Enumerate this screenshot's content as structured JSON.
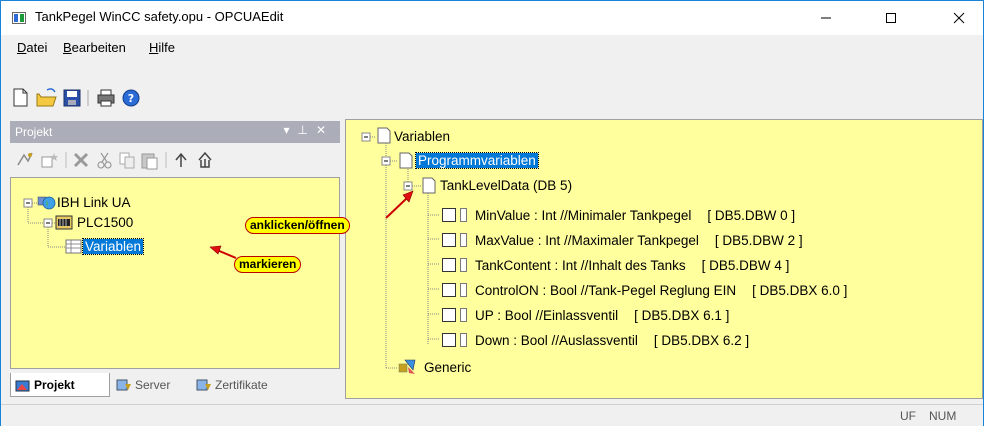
{
  "window": {
    "title": "TankPegel WinCC safety.opu - OPCUAEdit"
  },
  "menu": [
    {
      "label": "Datei",
      "mnemonic": "D",
      "rest": "atei"
    },
    {
      "label": "Bearbeiten",
      "mnemonic": "B",
      "rest": "earbeiten"
    },
    {
      "label": "Hilfe",
      "mnemonic": "H",
      "rest": "ilfe"
    }
  ],
  "toolbar": [
    "new-file-icon",
    "open-folder-icon",
    "save-icon",
    "print-icon",
    "help-icon"
  ],
  "left_panel": {
    "title": "Projekt",
    "tools": [
      "add-connection-icon",
      "add-item-icon",
      "delete-icon",
      "cut-icon",
      "copy-icon",
      "paste-icon",
      "arrow-up-icon",
      "home-up-icon"
    ],
    "tree": {
      "root": "IBH Link UA",
      "plc": "PLC1500",
      "variables": "Variablen"
    },
    "tabs": [
      {
        "label": "Projekt",
        "active": true
      },
      {
        "label": "Server",
        "active": false
      },
      {
        "label": "Zertifikate",
        "active": false
      }
    ]
  },
  "annotations": {
    "open": "anklicken/öffnen",
    "mark": "markieren"
  },
  "right_panel": {
    "root": "Variablen",
    "program_vars": "Programmvariablen",
    "db": "TankLevelData (DB 5)",
    "items": [
      {
        "label": "MinValue : Int //Minimaler Tankpegel",
        "address": "[ DB5.DBW 0 ]"
      },
      {
        "label": "MaxValue : Int //Maximaler Tankpegel",
        "address": "[ DB5.DBW 2 ]"
      },
      {
        "label": "TankContent : Int //Inhalt des Tanks",
        "address": "[ DB5.DBW 4 ]"
      },
      {
        "label": "ControlON : Bool //Tank-Pegel Reglung EIN",
        "address": "[ DB5.DBX 6.0 ]"
      },
      {
        "label": "UP : Bool //Einlassventil",
        "address": "[ DB5.DBX 6.1 ]"
      },
      {
        "label": "Down : Bool //Auslassventil",
        "address": "[ DB5.DBX 6.2 ]"
      }
    ],
    "generic": "Generic"
  },
  "status": {
    "uf": "UF",
    "num": "NUM"
  },
  "colors": {
    "tree_bg": "#ffff9e",
    "selection": "#0078d7",
    "callout": "#ffff00",
    "arrow": "#e01010"
  }
}
